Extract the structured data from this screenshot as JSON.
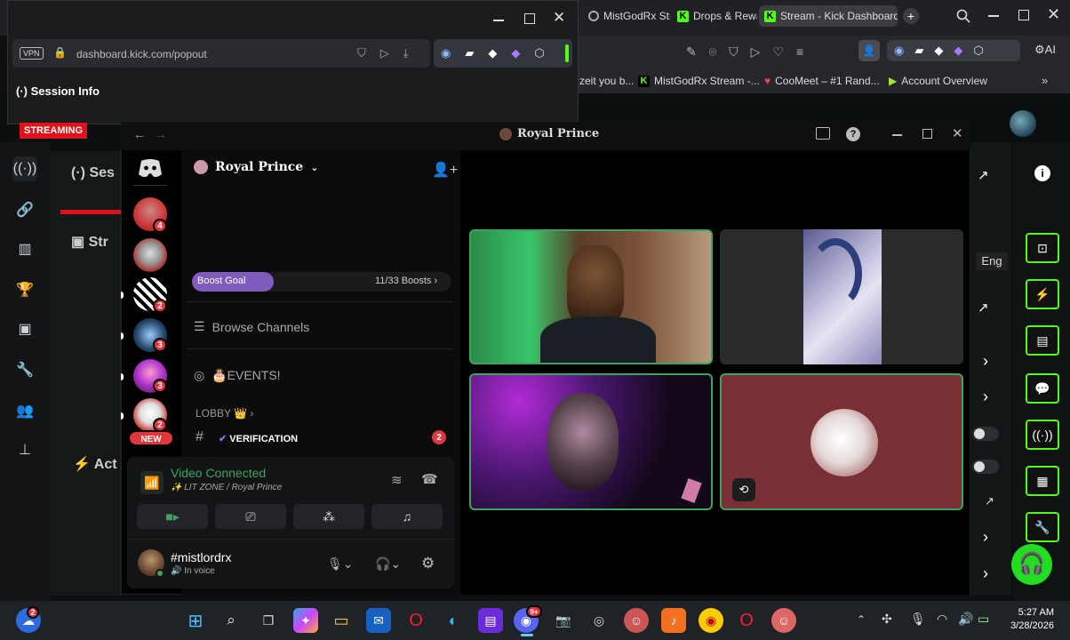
{
  "browser": {
    "tabs": [
      {
        "label": "MistGodRx Str"
      },
      {
        "label": "Drops & Rewa"
      },
      {
        "label": "Stream - Kick Dashboard"
      }
    ],
    "bookmarks": [
      {
        "label": "zeit you b..."
      },
      {
        "label": "MistGodRx Stream -..."
      },
      {
        "label": "CooMeet – #1 Rand..."
      },
      {
        "label": "Account Overview"
      }
    ],
    "ai_label": "AI"
  },
  "popout": {
    "vpn": "VPN",
    "url": "dashboard.kick.com/popout",
    "session_title": "Session Info",
    "streaming_badge": "STREAMING"
  },
  "kick": {
    "partial_labels": {
      "ses": "Ses",
      "str": "Str",
      "act": "Act",
      "eng": "Eng"
    }
  },
  "discord": {
    "window_title": "Royal Prince",
    "server_name": "Royal Prince",
    "boost_goal": "Boost Goal",
    "boosts": "11/33 Boosts",
    "browse_channels": "Browse Channels",
    "events": "🎂EVENTS!",
    "lobby": "LOBBY 👑",
    "verification": "VERIFICATION",
    "verification_badge": "2",
    "new_badge": "NEW",
    "voice_status": "Video Connected",
    "voice_channel": "LIT ZONE / Royal Prince",
    "username": "#mistlordrx",
    "user_status": "In voice",
    "server_badges": [
      "4",
      "2",
      "3",
      "3",
      "2"
    ]
  },
  "taskbar": {
    "time": "5:27 AM",
    "date": "3/28/2026",
    "notif_badge": "2",
    "discord_badge": "9+"
  },
  "colors": {
    "kick_green": "#53fc18",
    "discord_red": "#e0363d",
    "boost_purple": "#7e5bbd",
    "voice_green": "#3ba55d"
  }
}
